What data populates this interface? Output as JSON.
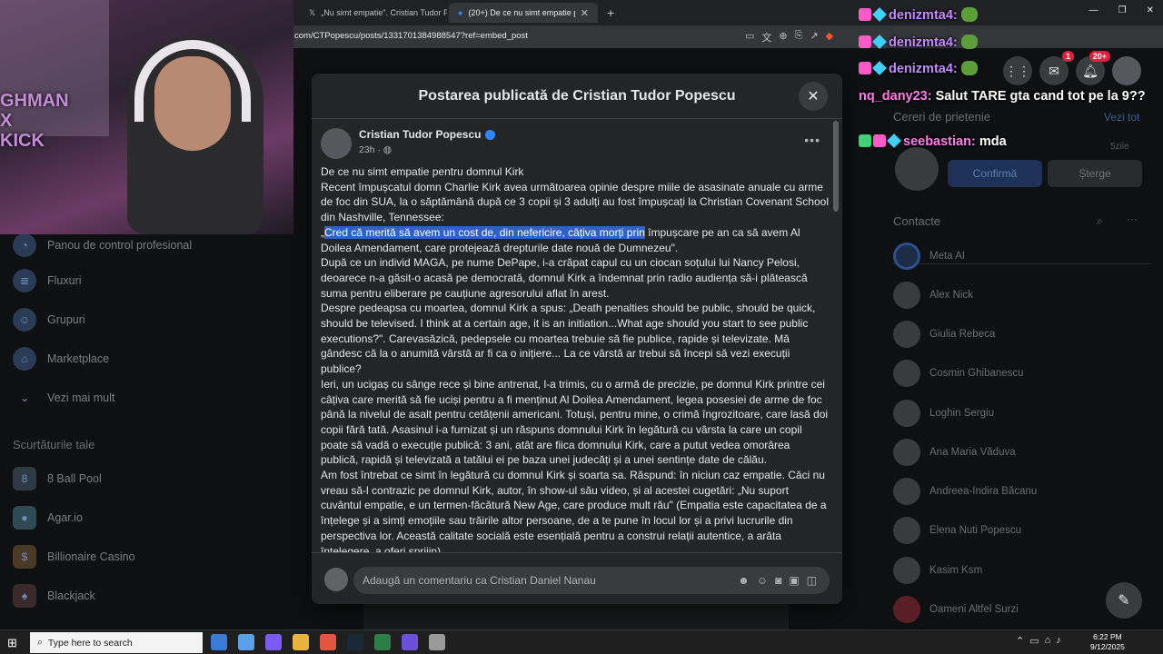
{
  "browser": {
    "tabs": [
      {
        "label": "„Nu simt empatie\". Cristian Tudor Po",
        "active": false
      },
      {
        "label": "(20+) De ce nu simt empatie pe",
        "active": true
      }
    ],
    "new_tab_symbol": "+",
    "url": "com/CTPopescu/posts/1331701384988547?ref=embed_post",
    "icons": [
      "screen-icon",
      "translate-icon",
      "zoom-icon",
      "cast-icon",
      "share-icon",
      "brave-icon"
    ]
  },
  "facebook": {
    "left_nav": [
      {
        "label": "Panou de control profesional",
        "icon": "dashboard-icon"
      },
      {
        "label": "Fluxuri",
        "icon": "feeds-icon"
      },
      {
        "label": "Grupuri",
        "icon": "groups-icon"
      },
      {
        "label": "Marketplace",
        "icon": "marketplace-icon"
      },
      {
        "label": "Vezi mai mult",
        "icon": "chevron-down-icon"
      }
    ],
    "shortcuts_title": "Scurtăturile tale",
    "shortcuts": [
      {
        "label": "8 Ball Pool"
      },
      {
        "label": "Agar.io"
      },
      {
        "label": "Billionaire Casino"
      },
      {
        "label": "Blackjack"
      }
    ],
    "friend_requests": {
      "title": "Cereri de prietenie",
      "see_all": "Vezi tot",
      "weeks": "5zile",
      "confirm": "Confirmă",
      "delete": "Șterge"
    },
    "contacts_title": "Contacte",
    "contacts": [
      "Meta AI",
      "Alex Nick",
      "Giulia Rebeca",
      "Cosmin Ghibanescu",
      "Loghin Sergiu",
      "Ana Maria Văduva",
      "Andreea-Indira Băcanu",
      "Elena Nuti Popescu",
      "Kasim Ksm",
      "Oameni Altfel Surzi"
    ],
    "messenger_badge": "1",
    "notifications_badge": "20+"
  },
  "modal": {
    "title": "Postarea publicată de Cristian Tudor Popescu",
    "close": "✕",
    "author": "Cristian Tudor Popescu",
    "time": "23h · ",
    "post_title": "De ce nu simt empatie pentru domnul Kirk",
    "p1": " Recent împușcatul domn Charlie Kirk avea următoarea opinie despre miile de asasinate anuale cu arme de foc din SUA, la o săptămână după ce 3 copii și 3 adulți au fost împușcați la Christian Covenant School din Nashville, Tennessee:",
    "p2_pre": " „",
    "p2_highlight": "Cred că merită să avem un cost de, din nefericire, câțiva morți prin",
    "p2_post": " împușcare pe an ca să avem Al Doilea Amendament, care protejează drepturile date nouă de Dumnezeu\".",
    "p3": " După ce un individ MAGA, pe nume DePape, i-a crăpat capul cu un ciocan soțului lui Nancy Pelosi, deoarece n-a găsit-o acasă pe democrată, domnul Kirk a îndemnat prin radio audiența să-i plătească suma pentru eliberare pe cauțiune agresorului aflat în arest.",
    "p4": " Despre pedeapsa cu moartea, domnul Kirk a spus: „Death penalties should be public, should be quick, should be televised. I think at a certain age, it is an initiation...What age should you start to see public executions?\". Carevasăzică, pedepsele cu moartea trebuie să fie publice, rapide și televizate. Mă gândesc că la o anumită vârstă ar fi ca o inițiere... La ce vârstă ar trebui să începi să vezi execuții publice?",
    "p5": " Ieri, un ucigaș cu sânge rece și bine antrenat, l-a trimis, cu o armă de precizie, pe domnul Kirk printre cei câțiva care merită să fie uciși pentru a fi menținut Al Doilea Amendament, legea posesiei de arme de foc până la nivelul de asalt pentru cetățenii americani. Totuși, pentru mine, o crimă îngrozitoare, care lasă doi copii fără tată. Asasinul i-a furnizat și un răspuns domnului Kirk în legătură cu vârsta la care un copil poate să vadă o execuție publică: 3 ani, atât are fiica domnului Kirk, care a putut vedea omorârea publică, rapidă și televizată a tatălui ei pe baza unei judecăți și a unei sentințe date de călău.",
    "p6": "Am fost întrebat ce simt în legătură cu domnul Kirk și soarta sa. Răspund: în niciun caz empatie. Căci nu vreau să-l contrazic pe domnul Kirk, autor, în show-ul său video, și al acestei cugetări: „Nu suport cuvântul empatie, e un termen-făcătură New Age, care produce mult rău\" (Empatia este capacitatea de a înțelege și a simți emoțiile sau trăirile altor persoane, de a te pune în locul lor și a privi lucrurile din perspectiva lor. Această calitate socială este esențială pentru a construi relații autentice, a arăta înțelegere, a oferi sprijin).",
    "comment_placeholder": "Adaugă un comentariu ca Cristian Daniel Nanau"
  },
  "stream": {
    "cam_logo": "GHMAN\nX\nKICK",
    "chat": [
      {
        "user": "denizmta4:",
        "msg": "",
        "color": "#c28bff"
      },
      {
        "user": "denizmta4:",
        "msg": "",
        "color": "#c28bff"
      },
      {
        "user": "denizmta4:",
        "msg": "",
        "color": "#c28bff"
      },
      {
        "user": "nq_dany23:",
        "msg": " Salut TARE gta cand tot pe la 9??",
        "color": "#ff7de9"
      },
      {
        "user": "seebastian:",
        "msg": " mda",
        "color": "#ff7de9"
      }
    ]
  },
  "taskbar": {
    "search_placeholder": "Type here to search",
    "time": "6:22 PM",
    "date": "9/12/2025"
  }
}
